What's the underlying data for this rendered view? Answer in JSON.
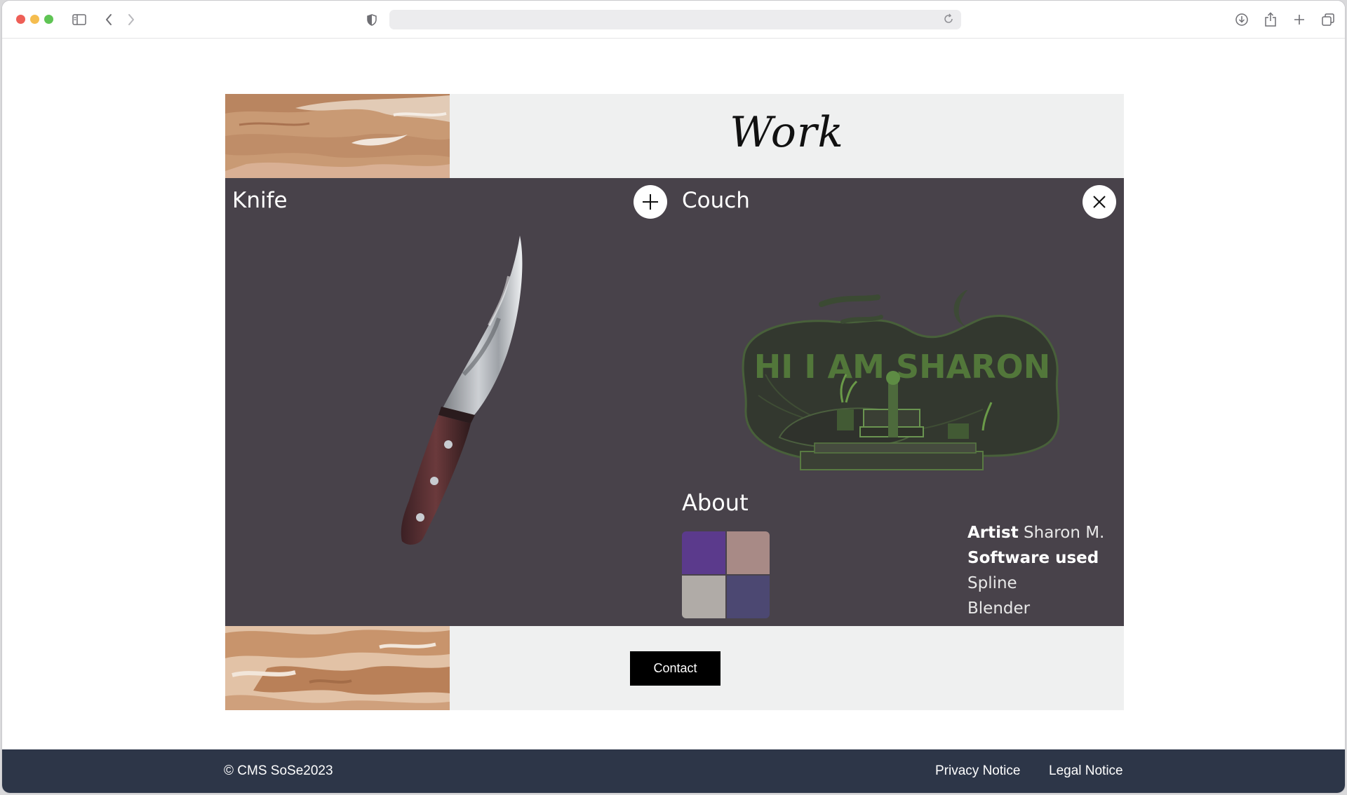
{
  "browser": {
    "address_value": "",
    "icons": [
      "sidebar-icon",
      "back-icon",
      "forward-icon",
      "shield-icon",
      "reload-icon",
      "download-icon",
      "share-icon",
      "new-tab-icon",
      "tab-overview-icon"
    ]
  },
  "header": {
    "title": "Work"
  },
  "gallery": {
    "left_item": {
      "title": "Knife",
      "image": "knife-render"
    },
    "add_button_icon": "plus-icon",
    "right_item": {
      "title": "Couch",
      "image": "couch-scene-render",
      "scene_text": "HI I AM SHARON"
    },
    "close_button_icon": "close-icon",
    "about": {
      "title": "About",
      "swatches": [
        "#5b3a8c",
        "#a88a86",
        "#b0aba7",
        "#4c4872"
      ],
      "artist_label": "Artist",
      "artist_name": "Sharon M.",
      "software_label": "Software used",
      "software": [
        "Spline",
        "Blender"
      ]
    }
  },
  "contact": {
    "button_label": "Contact"
  },
  "footer": {
    "copyright": "© CMS SoSe2023",
    "links": [
      "Privacy Notice",
      "Legal Notice"
    ]
  },
  "colors": {
    "gallery_bg": "#48424a",
    "band_bg": "#eff0f0",
    "footer_bg": "#2d3648",
    "button_bg": "#000000"
  }
}
